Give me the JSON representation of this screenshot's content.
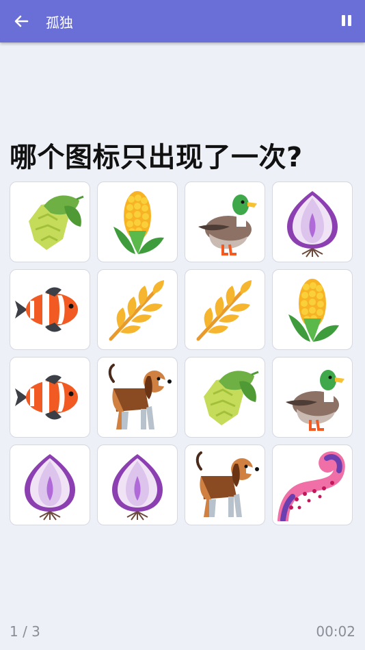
{
  "header": {
    "title": "孤独",
    "back_icon": "arrow-left-icon",
    "pause_icon": "pause-icon",
    "background": "#6a6fd8"
  },
  "question": "哪个图标只出现了一次?",
  "grid": {
    "rows": 4,
    "cols": 4,
    "tiles": [
      [
        "hop-icon",
        "corn-icon",
        "duck-icon",
        "onion-icon"
      ],
      [
        "clownfish-icon",
        "wheat-icon",
        "wheat-icon",
        "corn-icon"
      ],
      [
        "clownfish-icon",
        "dog-icon",
        "hop-icon",
        "duck-icon"
      ],
      [
        "onion-icon",
        "onion-icon",
        "dog-icon",
        "octopus-tentacle-icon"
      ]
    ]
  },
  "footer": {
    "progress": "1 / 3",
    "timer": "00:02"
  }
}
